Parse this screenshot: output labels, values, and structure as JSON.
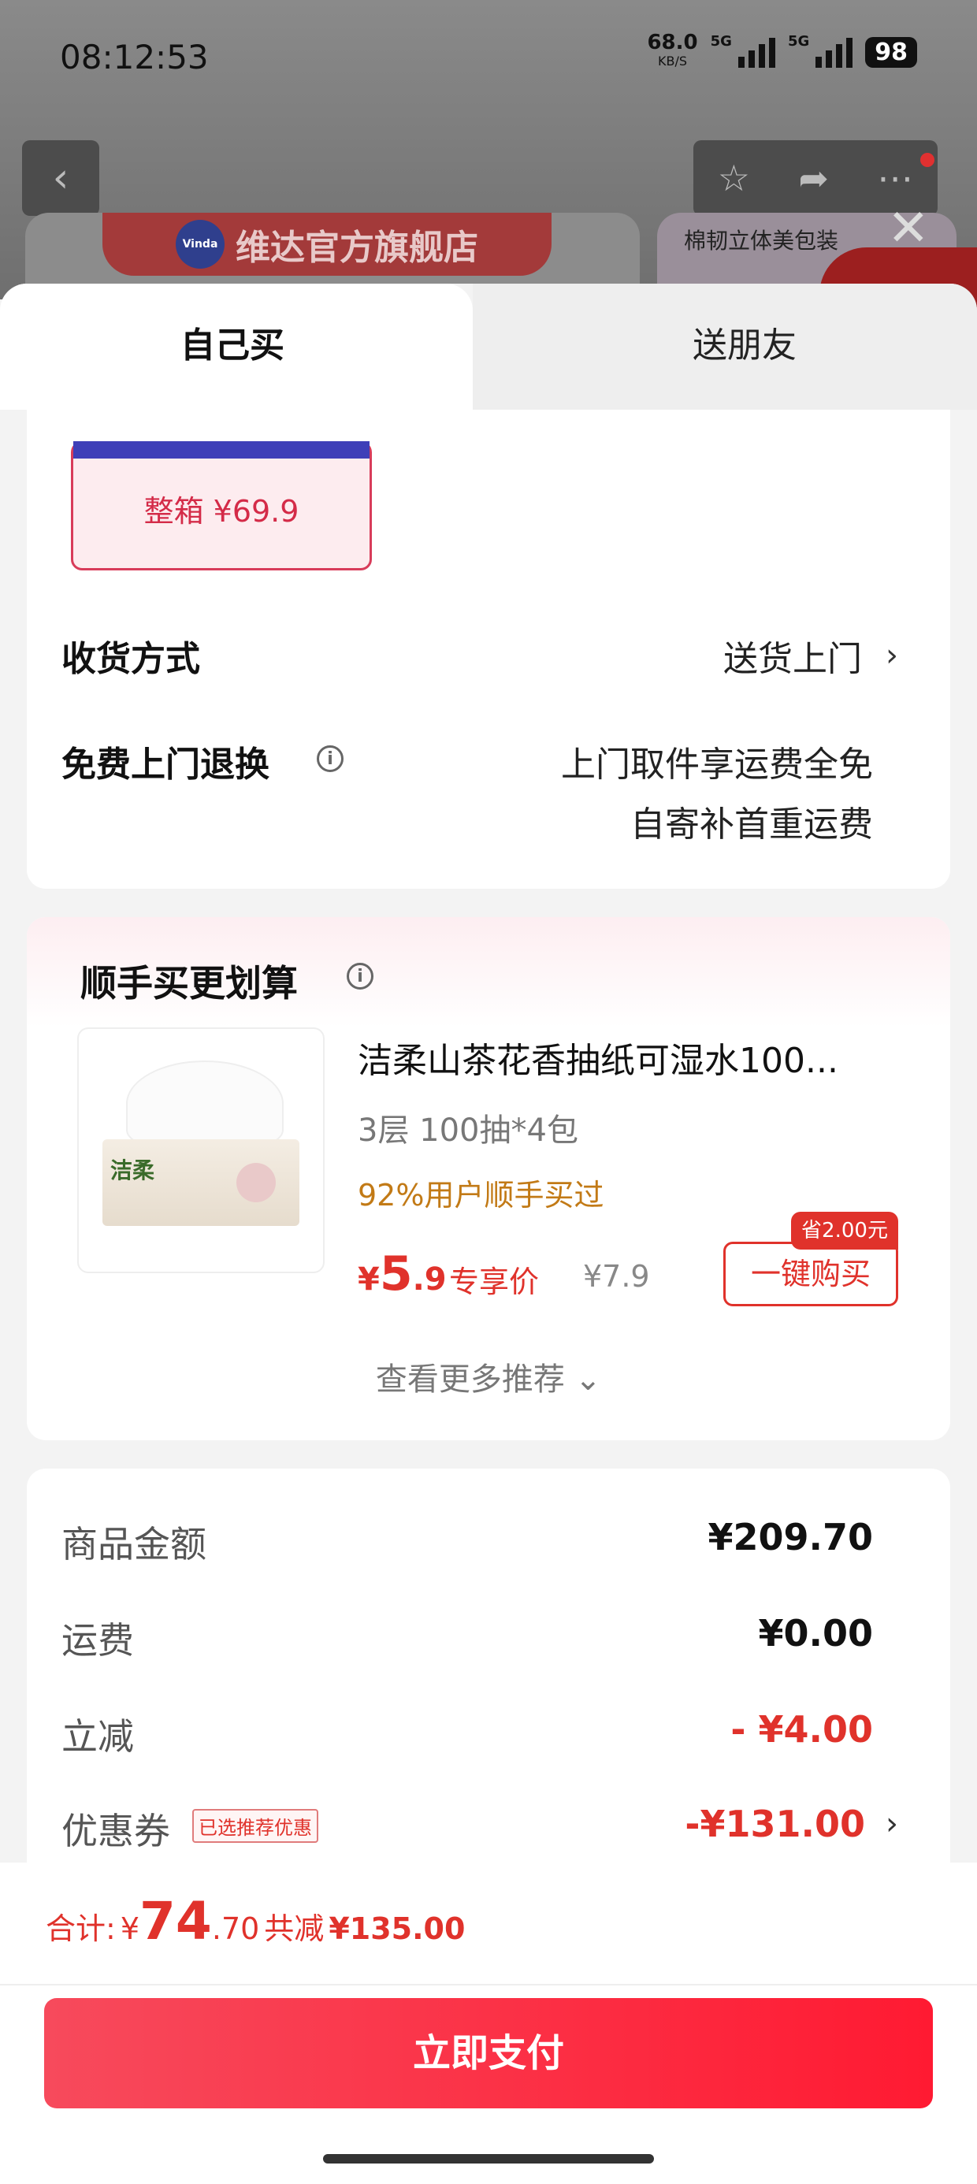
{
  "status_bar": {
    "time": "08:12:53",
    "net_speed": "68.0",
    "net_unit": "KB/S",
    "sig1": "5G",
    "sig2": "5G",
    "battery": "98"
  },
  "header": {
    "banner_store": "维达官方旗舰店",
    "logo_text": "Vinda",
    "banner_right_text": "棉韧立体美包装"
  },
  "tabs": {
    "self": "自己买",
    "friend": "送朋友"
  },
  "sku": {
    "label": "整箱 ¥69.9"
  },
  "delivery": {
    "label": "收货方式",
    "value": "送货上门"
  },
  "return_policy": {
    "label": "免费上门退换",
    "line1": "上门取件享运费全免",
    "line2": "自寄补首重运费"
  },
  "recommend": {
    "title": "顺手买更划算",
    "product": {
      "name": "洁柔山茶花香抽纸可湿水100...",
      "spec": "3层 100抽*4包",
      "bought": "92%用户顺手买过",
      "price_symbol": "¥",
      "price_int": "5",
      "price_dec": ".9",
      "price_tag": "专享价",
      "orig_price": "¥7.9",
      "save_tag": "省2.00元",
      "buy_button": "一键购买",
      "brand_on_pack": "洁柔"
    },
    "more": "查看更多推荐 ⌄"
  },
  "summary": {
    "goods_label": "商品金额",
    "goods_value": "¥209.70",
    "shipping_label": "运费",
    "shipping_value": "¥0.00",
    "discount_label": "立减",
    "discount_value": "- ¥4.00",
    "coupon_label": "优惠券",
    "coupon_badge": "已选推荐优惠",
    "coupon_value": "-¥131.00"
  },
  "footer": {
    "total_label": "合计:",
    "total_symbol": "¥",
    "total_int": "74",
    "total_dec": ".70",
    "saved_label": "共减",
    "saved_value": "¥135.00",
    "pay_button": "立即支付"
  },
  "colors": {
    "accent_red": "#e0322b",
    "pay_gradient_start": "#f74a5c",
    "pay_gradient_end": "#ff1a32",
    "orange_text": "#c27a16"
  }
}
